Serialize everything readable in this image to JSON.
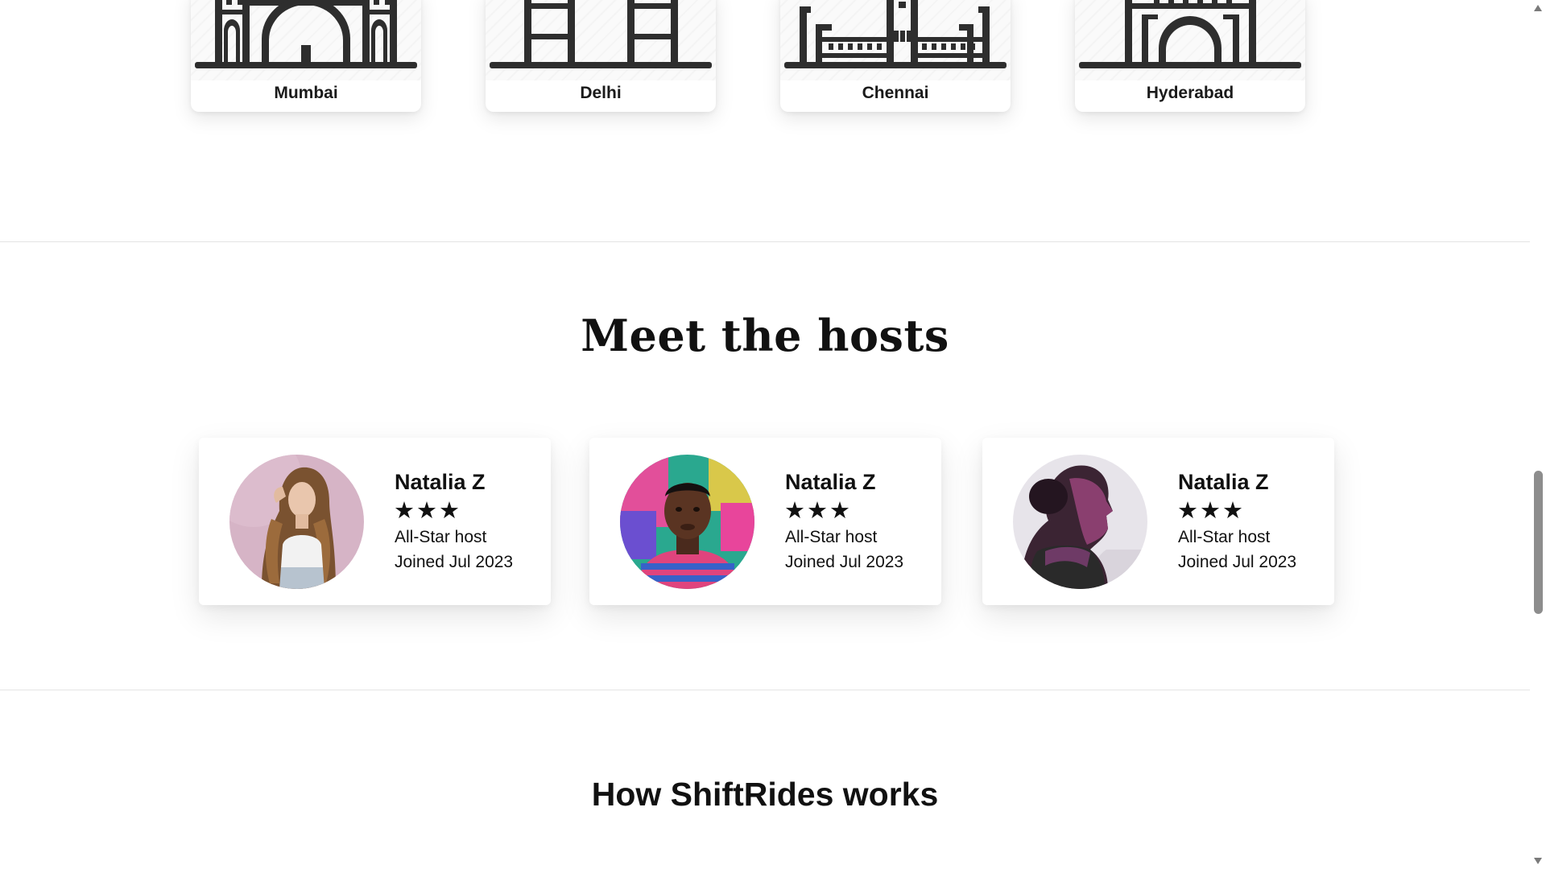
{
  "cities": [
    {
      "name": "Mumbai",
      "icon": "mumbai-landmark-icon"
    },
    {
      "name": "Delhi",
      "icon": "delhi-landmark-icon"
    },
    {
      "name": "Chennai",
      "icon": "chennai-landmark-icon"
    },
    {
      "name": "Hyderabad",
      "icon": "hyderabad-landmark-icon"
    }
  ],
  "hosts_section": {
    "title": "Meet the hosts",
    "hosts": [
      {
        "name": "Natalia Z",
        "stars": "★★★",
        "rating": 3,
        "badge": "All-Star host",
        "joined": "Joined Jul 2023"
      },
      {
        "name": "Natalia Z",
        "stars": "★★★",
        "rating": 3,
        "badge": "All-Star host",
        "joined": "Joined Jul 2023"
      },
      {
        "name": "Natalia Z",
        "stars": "★★★",
        "rating": 3,
        "badge": "All-Star host",
        "joined": "Joined Jul 2023"
      }
    ]
  },
  "how_section": {
    "title": "How ShiftRides works"
  },
  "colors": {
    "text": "#111111",
    "icon": "#2e2e2e",
    "divider": "#e4e4e4",
    "scroll_thumb": "#8d8d8d"
  }
}
